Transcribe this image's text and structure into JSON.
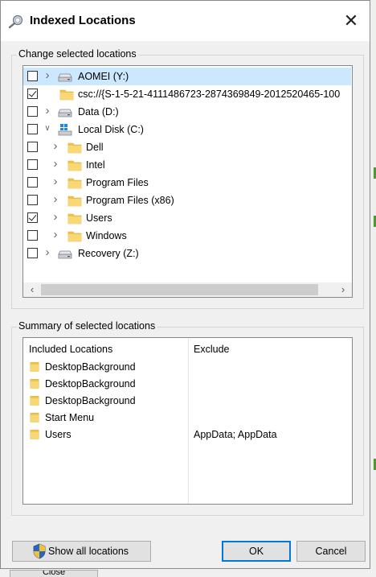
{
  "dialog": {
    "title": "Indexed Locations",
    "close_symbol": "✕"
  },
  "change_group": {
    "label": "Change selected locations",
    "tree": [
      {
        "label": "AOMEI (Y:)",
        "checked": false,
        "expandable": true,
        "icon": "drive-icon",
        "level": 0,
        "selected": true
      },
      {
        "label": "csc://{S-1-5-21-4111486723-2874369849-2012520465-100",
        "checked": true,
        "expandable": false,
        "icon": "folder-icon",
        "level": 0,
        "selected": false
      },
      {
        "label": "Data (D:)",
        "checked": false,
        "expandable": true,
        "icon": "drive-icon",
        "level": 0,
        "selected": false
      },
      {
        "label": "Local Disk (C:)",
        "checked": false,
        "expandable": true,
        "expanded": true,
        "icon": "windows-drive-icon",
        "level": 0,
        "selected": false
      },
      {
        "label": "Dell",
        "checked": false,
        "expandable": true,
        "icon": "folder-icon",
        "level": 1,
        "selected": false
      },
      {
        "label": "Intel",
        "checked": false,
        "expandable": true,
        "icon": "folder-icon",
        "level": 1,
        "selected": false
      },
      {
        "label": "Program Files",
        "checked": false,
        "expandable": true,
        "icon": "folder-icon",
        "level": 1,
        "selected": false
      },
      {
        "label": "Program Files (x86)",
        "checked": false,
        "expandable": true,
        "icon": "folder-icon",
        "level": 1,
        "selected": false
      },
      {
        "label": "Users",
        "checked": true,
        "expandable": true,
        "icon": "folder-icon",
        "level": 1,
        "selected": false
      },
      {
        "label": "Windows",
        "checked": false,
        "expandable": true,
        "icon": "folder-icon",
        "level": 1,
        "selected": false
      },
      {
        "label": "Recovery (Z:)",
        "checked": false,
        "expandable": true,
        "icon": "drive-icon",
        "level": 0,
        "selected": false
      }
    ]
  },
  "summary_group": {
    "label": "Summary of selected locations",
    "columns": [
      "Included Locations",
      "Exclude"
    ],
    "rows": [
      {
        "location": "DesktopBackground",
        "exclude": ""
      },
      {
        "location": "DesktopBackground",
        "exclude": ""
      },
      {
        "location": "DesktopBackground",
        "exclude": ""
      },
      {
        "location": "Start Menu",
        "exclude": ""
      },
      {
        "location": "Users",
        "exclude": "AppData; AppData"
      }
    ]
  },
  "buttons": {
    "show_all": "Show all locations",
    "ok": "OK",
    "cancel": "Cancel"
  },
  "background": {
    "close_label": "Close"
  },
  "colors": {
    "selection": "#cce8ff",
    "folder": "#f3c24b",
    "accent": "#0078d7"
  }
}
